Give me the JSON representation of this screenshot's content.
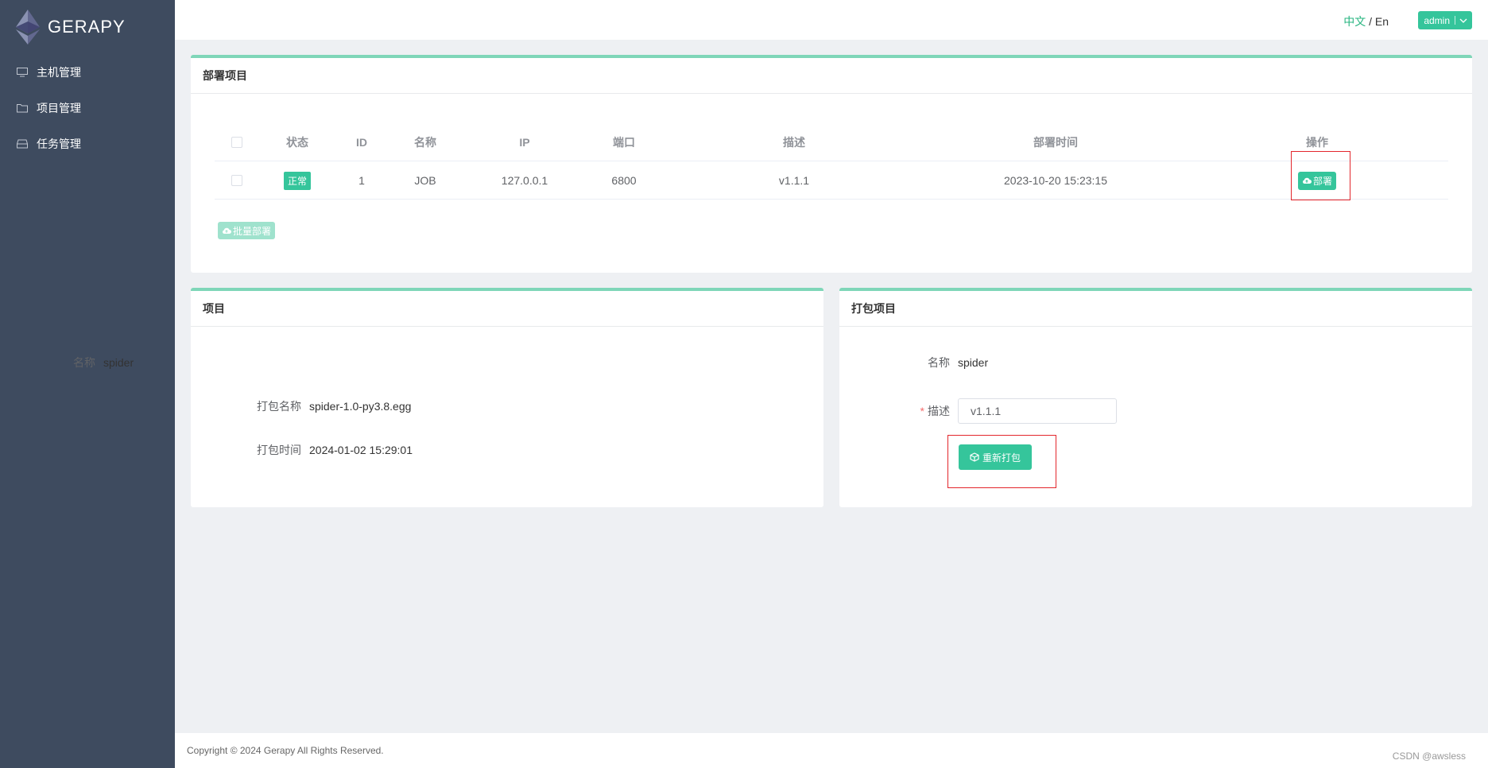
{
  "app": {
    "name": "GERAPY"
  },
  "sidebar": {
    "items": [
      {
        "label": "主机管理",
        "icon": "monitor-icon"
      },
      {
        "label": "项目管理",
        "icon": "folder-icon"
      },
      {
        "label": "任务管理",
        "icon": "inbox-icon"
      }
    ]
  },
  "header": {
    "lang_zh": "中文",
    "lang_sep": " / ",
    "lang_en": "En",
    "user": "admin"
  },
  "deploy_panel": {
    "title": "部署项目",
    "columns": [
      "状态",
      "ID",
      "名称",
      "IP",
      "端口",
      "描述",
      "部署时间",
      "操作"
    ],
    "rows": [
      {
        "status": "正常",
        "id": "1",
        "name": "JOB",
        "ip": "127.0.0.1",
        "port": "6800",
        "description": "v1.1.1",
        "deploy_time": "2023-10-20 15:23:15",
        "action": "部署"
      }
    ],
    "batch_label": "批量部署"
  },
  "project_panel": {
    "title": "项目",
    "name_label": "名称",
    "name_value": "spider",
    "package_label": "打包名称",
    "package_value": "spider-1.0-py3.8.egg",
    "time_label": "打包时间",
    "time_value": "2024-01-02 15:29:01"
  },
  "package_panel": {
    "title": "打包项目",
    "name_label": "名称",
    "name_value": "spider",
    "desc_label": "描述",
    "desc_value": "v1.1.1",
    "repack_label": "重新打包"
  },
  "footer": {
    "copyright": "Copyright © 2024 Gerapy All Rights Reserved.",
    "watermark": "CSDN @awsless"
  },
  "colors": {
    "sidebar_bg": "#3e4b5f",
    "accent": "#35c59b",
    "panel_border": "#7fd6b8",
    "highlight": "#e3262c"
  }
}
